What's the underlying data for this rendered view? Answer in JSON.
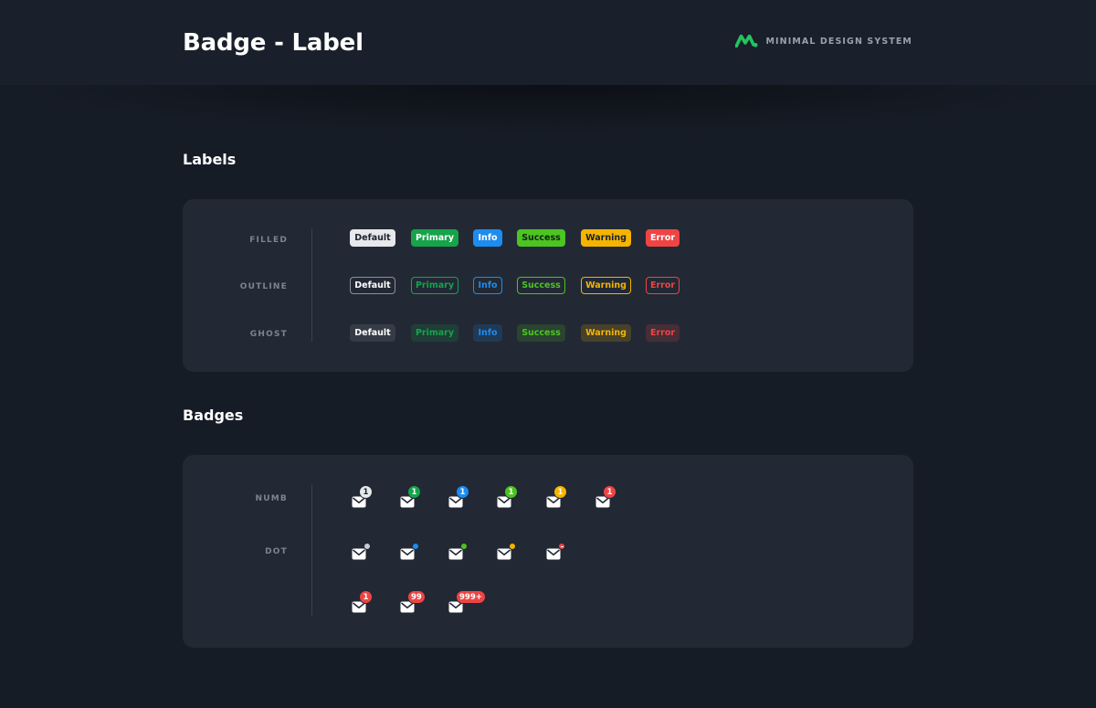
{
  "header": {
    "title": "Badge - Label",
    "brand": "MINIMAL DESIGN SYSTEM",
    "brand_color": "#22C55E"
  },
  "labels_section": {
    "title": "Labels",
    "rows": [
      {
        "name": "FILLED",
        "style": "filled"
      },
      {
        "name": "OUTLINE",
        "style": "outline"
      },
      {
        "name": "GHOST",
        "style": "ghost"
      }
    ],
    "variants": [
      "Default",
      "Primary",
      "Info",
      "Success",
      "Warning",
      "Error"
    ]
  },
  "badges_section": {
    "title": "Badges",
    "rows": [
      {
        "name": "NUMB",
        "values": [
          "1",
          "1",
          "1",
          "1",
          "1",
          "1"
        ]
      },
      {
        "name": "DOT"
      },
      {
        "name": "",
        "values": [
          "1",
          "99",
          "999+"
        ]
      }
    ]
  },
  "colors": {
    "default": "#E6E8EC",
    "primary": "#16A34A",
    "info": "#1D8CF0",
    "success": "#4CC421",
    "warning": "#F5B400",
    "error": "#EF4444"
  },
  "icons": {
    "item": "mail-icon",
    "logo": "brand-logo-icon"
  }
}
